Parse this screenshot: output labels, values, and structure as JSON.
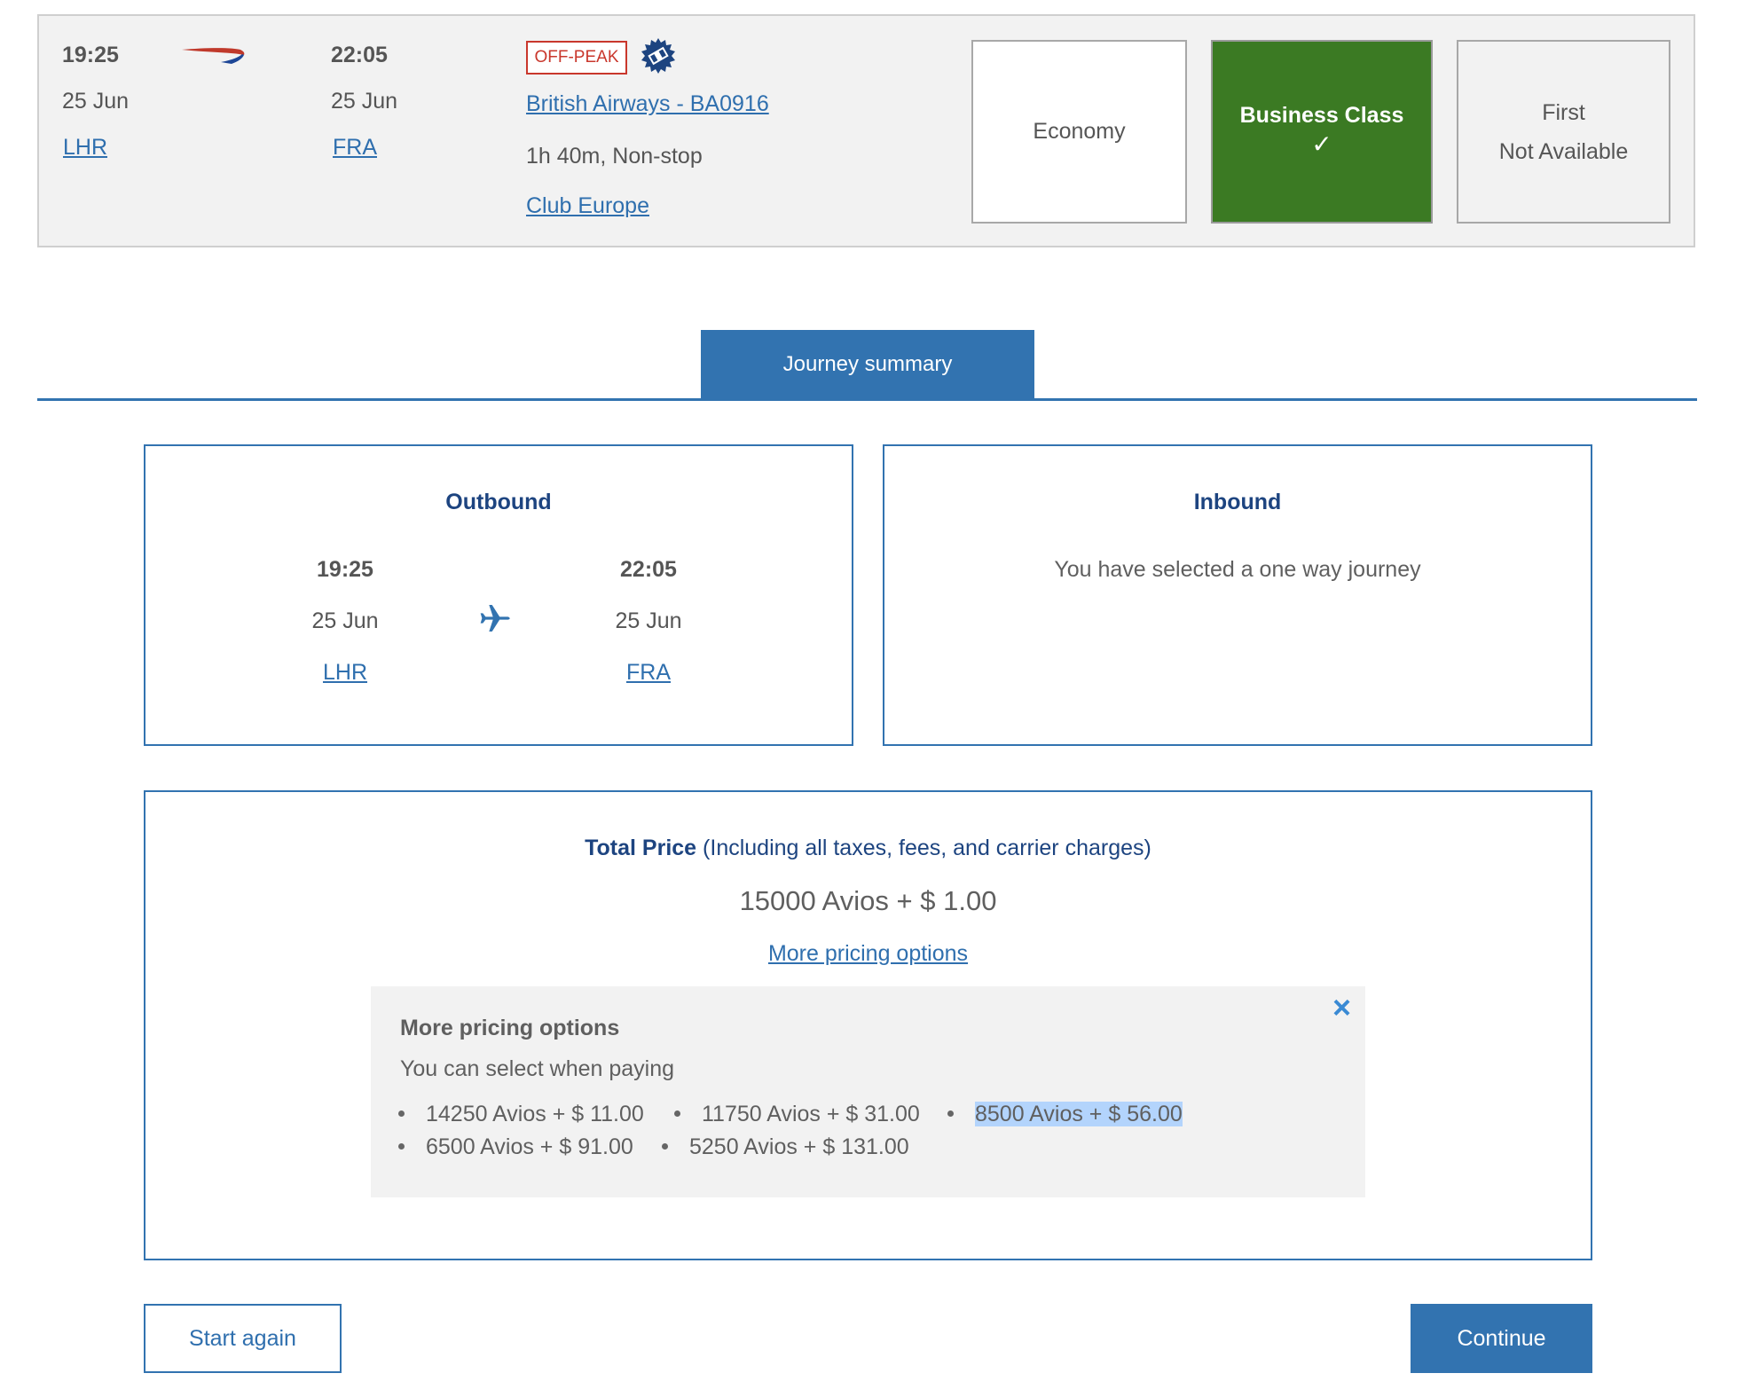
{
  "flight": {
    "depart_time": "19:25",
    "depart_date": "25 Jun",
    "depart_airport": "LHR",
    "arrive_time": "22:05",
    "arrive_date": "25 Jun",
    "arrive_airport": "FRA",
    "fare_badge": "OFF-PEAK",
    "airline_flight": "British Airways - BA0916",
    "duration": "1h 40m, Non-stop",
    "cabin_name": "Club Europe"
  },
  "cabins": {
    "economy": "Economy",
    "business": "Business Class",
    "business_check": "✓",
    "first": "First",
    "first_status": "Not Available"
  },
  "tab": {
    "journey_summary": "Journey summary"
  },
  "outbound": {
    "title": "Outbound",
    "depart_time": "19:25",
    "depart_date": "25 Jun",
    "depart_airport": "LHR",
    "arrive_time": "22:05",
    "arrive_date": "25 Jun",
    "arrive_airport": "FRA"
  },
  "inbound": {
    "title": "Inbound",
    "message": "You have selected a one way journey"
  },
  "price": {
    "label": "Total Price",
    "note": "(Including all taxes, fees, and carrier charges)",
    "total": "15000 Avios + $ 1.00",
    "more_link": "More pricing options"
  },
  "pricing_options": {
    "title": "More pricing options",
    "subtitle": "You can select when paying",
    "options": [
      "14250 Avios + $ 11.00",
      "11750 Avios + $ 31.00",
      "8500 Avios + $ 56.00",
      "6500 Avios + $ 91.00",
      "5250 Avios + $ 131.00"
    ],
    "close_icon": "×"
  },
  "buttons": {
    "start_again": "Start again",
    "continue": "Continue"
  },
  "colors": {
    "brand_blue": "#3273b0",
    "selected_green": "#3b7a23",
    "offpeak_red": "#c9372c",
    "title_navy": "#1d4480"
  }
}
